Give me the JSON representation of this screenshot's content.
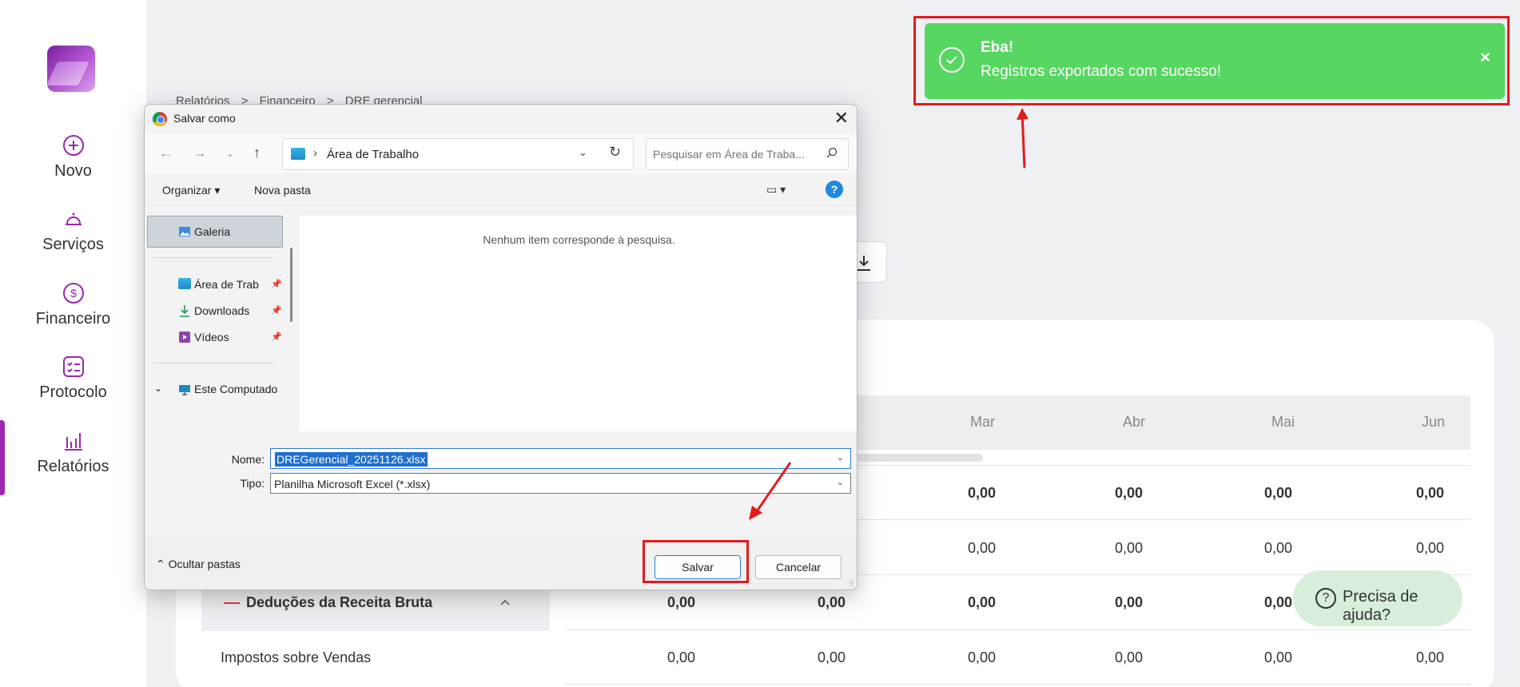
{
  "sidebar": {
    "items": [
      {
        "label": "Novo",
        "icon": "plus-circle-icon"
      },
      {
        "label": "Serviços",
        "icon": "bell-service-icon"
      },
      {
        "label": "Financeiro",
        "icon": "dollar-circle-icon"
      },
      {
        "label": "Protocolo",
        "icon": "checklist-icon"
      },
      {
        "label": "Relatórios",
        "icon": "bar-chart-icon"
      }
    ],
    "active": "Relatórios",
    "accent": "#9c27b0"
  },
  "breadcrumb": [
    "Relatórios",
    ">",
    "Financeiro",
    ">",
    "DRE gerencial"
  ],
  "table": {
    "months": [
      "Mar",
      "Abr",
      "Mai",
      "Jun"
    ],
    "rows": [
      {
        "label": "",
        "values": [
          "0,00",
          "0,00",
          "0,00",
          "0,00"
        ],
        "bold": true
      },
      {
        "label": "",
        "values": [
          "0,00",
          "0,00",
          "0,00",
          "0,00"
        ],
        "bold": false
      },
      {
        "label": "Deduções da Receita Bruta",
        "values": [
          "0,00",
          "0,00",
          "0,00",
          "0,00",
          "0,00",
          "0,00"
        ],
        "bold": true
      },
      {
        "label": "Impostos sobre Vendas",
        "values": [
          "0,00",
          "0,00",
          "0,00",
          "0,00",
          "0,00",
          "0,00"
        ],
        "bold": false
      }
    ]
  },
  "help_button": {
    "label": "Precisa de ajuda?"
  },
  "toast": {
    "title": "Eba!",
    "message": "Registros exportados com sucesso!",
    "close": "×",
    "color": "#57d661"
  },
  "dialog": {
    "title": "Salvar como",
    "close": "✕",
    "address": {
      "separator": "›",
      "path": "Área de Trabalho"
    },
    "search_placeholder": "Pesquisar em Área de Traba...",
    "toolbar": {
      "organize": "Organizar ▾",
      "new_folder": "Nova pasta",
      "help": "?"
    },
    "nav": {
      "gallery": "Galeria",
      "desktop": "Área de Trab",
      "downloads": "Downloads",
      "videos": "Vídeos",
      "computer": "Este Computado"
    },
    "empty_message": "Nenhum item corresponde à pesquisa.",
    "name_label": "Nome:",
    "name_value": "DREGerencial_20251126.xlsx",
    "type_label": "Tipo:",
    "type_value": "Planilha Microsoft Excel (*.xlsx)",
    "hide_folders": "Ocultar pastas",
    "save": "Salvar",
    "cancel": "Cancelar"
  },
  "annotation_color": "#e31b1b"
}
